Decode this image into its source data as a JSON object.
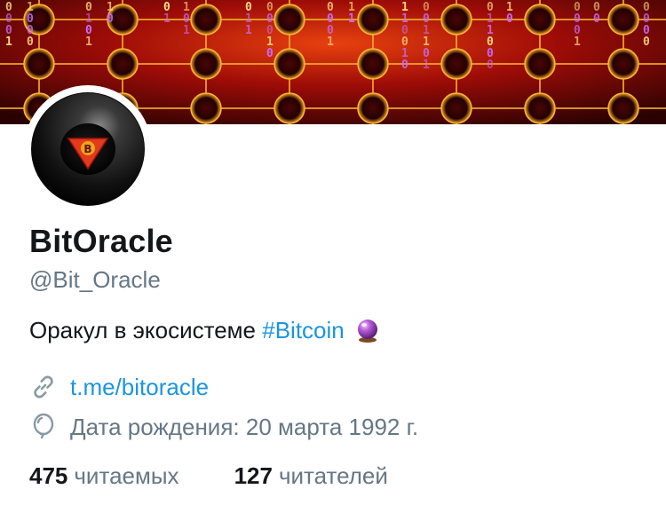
{
  "profile": {
    "display_name": "BitOracle",
    "handle": "@Bit_Oracle",
    "bio_text": "Оракул в экосистеме",
    "bio_hashtag": "#Bitcoin",
    "bio_emoji": "crystal-ball",
    "avatar_logo_letter": "B",
    "link": "t.me/bitoracle",
    "birthday": "Дата рождения: 20 марта 1992 г."
  },
  "stats": {
    "following_count": "475",
    "following_label": "читаемых",
    "followers_count": "127",
    "followers_label": "читателей"
  },
  "icons": {
    "link_icon": "link-icon",
    "birthday_icon": "balloon-icon"
  },
  "colors": {
    "text_primary": "#14171a",
    "text_secondary": "#657786",
    "link_blue": "#1b95e0",
    "banner_red": "#c0180c",
    "banner_dark": "#2a0303"
  }
}
